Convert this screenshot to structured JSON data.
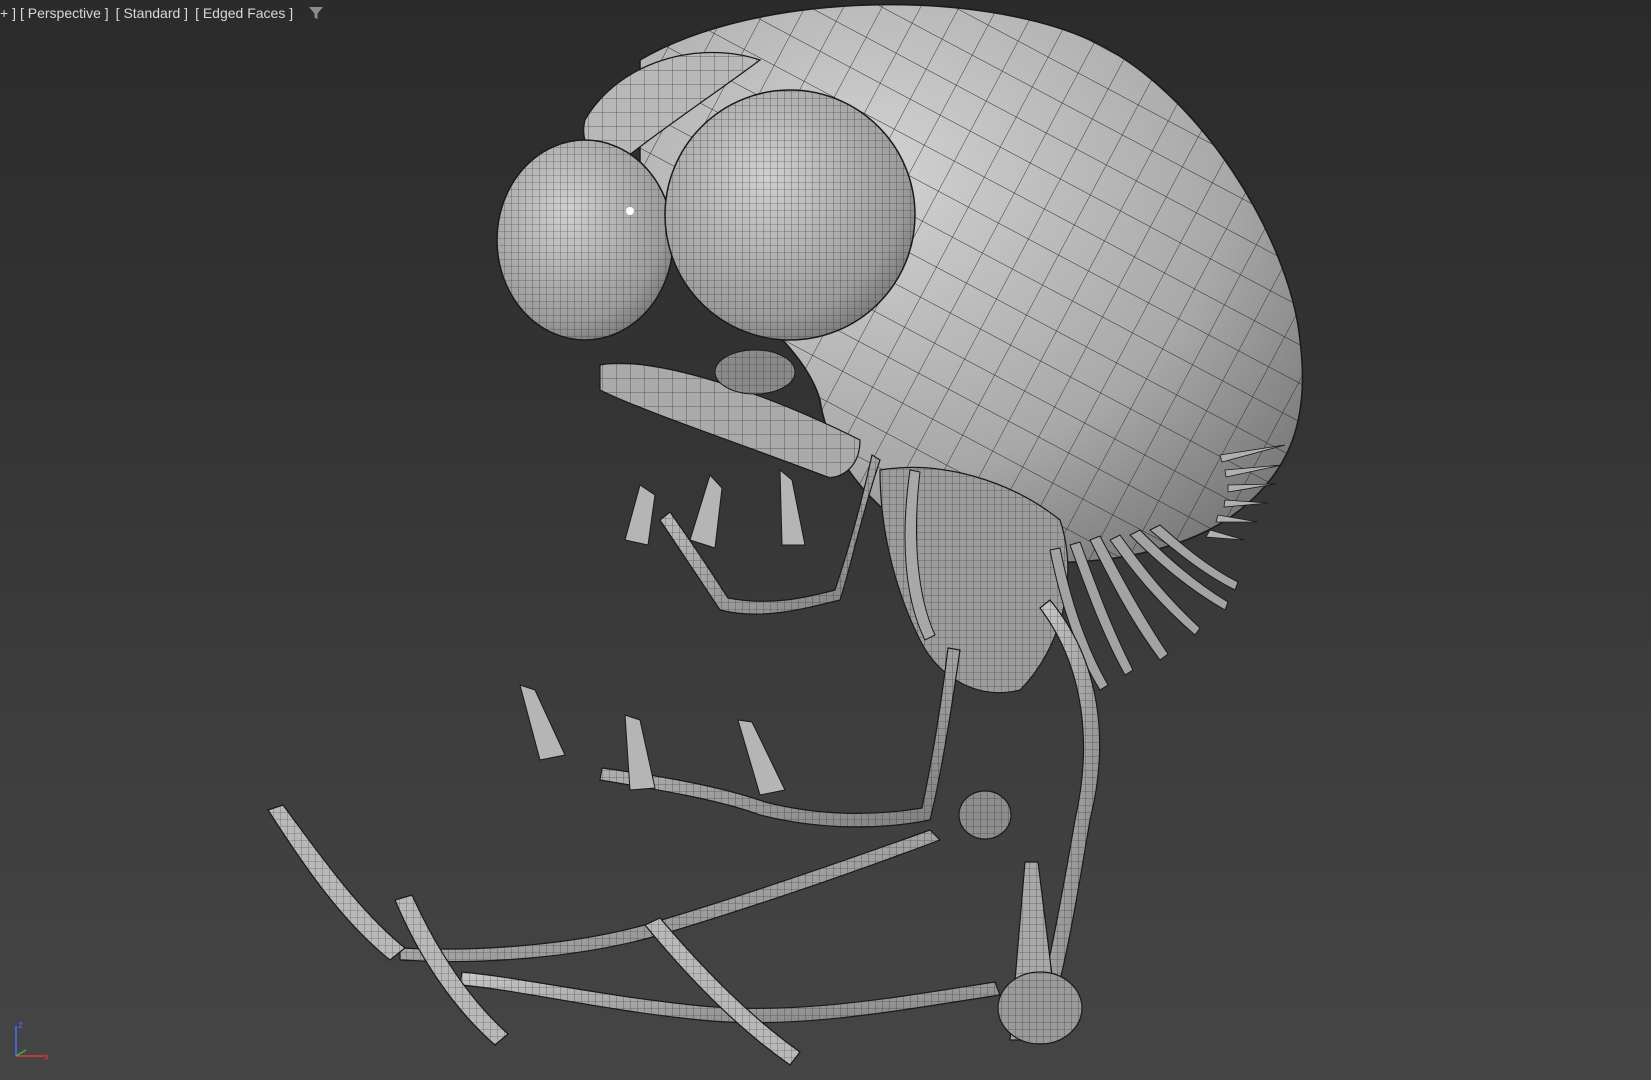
{
  "viewport": {
    "labels": {
      "plus": "+ ]",
      "view": "[ Perspective ]",
      "shading": "[ Standard ]",
      "display": "[ Edged Faces ]"
    },
    "filter_icon": "funnel-icon",
    "axis": {
      "z": "z",
      "x": "x"
    }
  },
  "colors": {
    "background_top": "#2b2b2b",
    "background_bottom": "#454545",
    "model_fill": "#9a9a9a",
    "wireframe": "#1a1a1a",
    "label_text": "#d8d8d8",
    "axis_z": "#4a6cff",
    "axis_x": "#e03a3a"
  }
}
